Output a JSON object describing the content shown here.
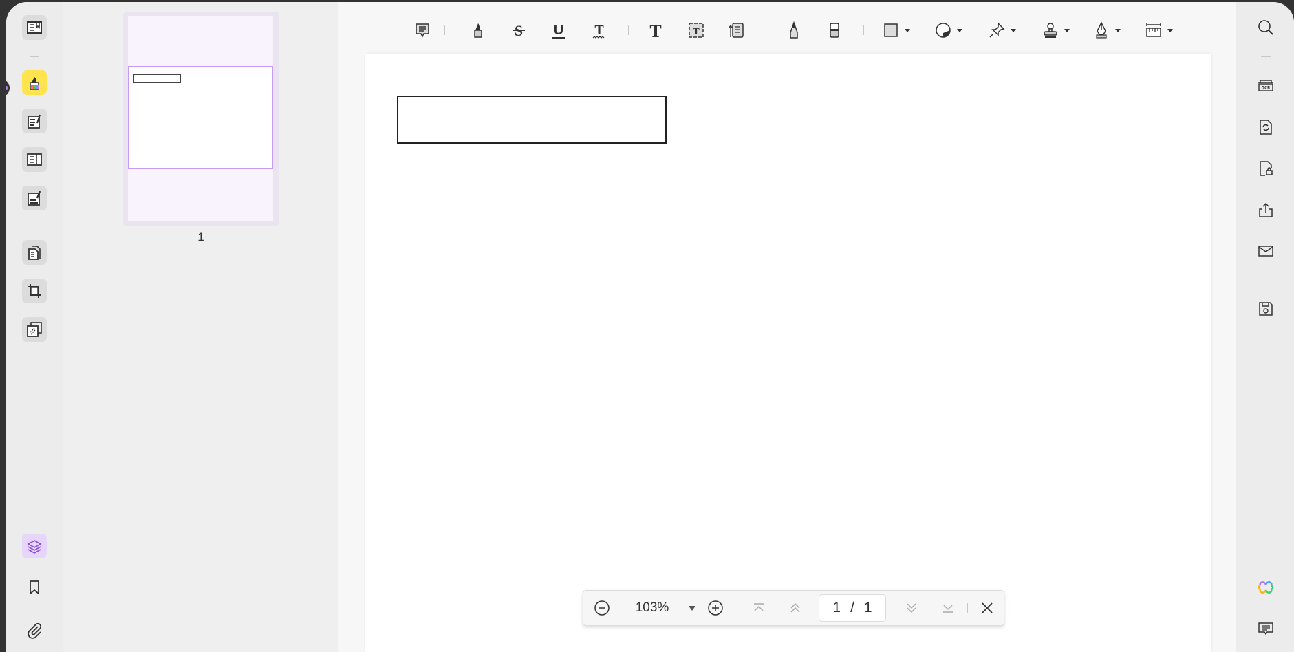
{
  "left_rail": {
    "items": [
      "read",
      "comment",
      "edit",
      "form",
      "redact",
      "organize",
      "crop",
      "batch"
    ],
    "bottom": [
      "layers",
      "bookmark",
      "attachment"
    ]
  },
  "thumbnails": {
    "pages": [
      {
        "label": "1"
      }
    ]
  },
  "toolbar": {
    "tools": [
      "sticky-note",
      "highlight",
      "strikethrough",
      "underline",
      "squiggly",
      "text",
      "text-box",
      "text-callout",
      "pencil",
      "eraser",
      "shape",
      "area-highlight",
      "pin",
      "stamp",
      "signature",
      "measure"
    ]
  },
  "right_rail": {
    "items": [
      "search",
      "ocr",
      "convert",
      "protect",
      "share",
      "email",
      "save",
      "ai-assistant",
      "comments"
    ]
  },
  "navbar": {
    "zoom": "103%",
    "page_current": "1",
    "page_separator": "/",
    "page_total": "1"
  },
  "colors": {
    "accent": "#b57cf0",
    "highlight_tile": "#ffe44d"
  }
}
